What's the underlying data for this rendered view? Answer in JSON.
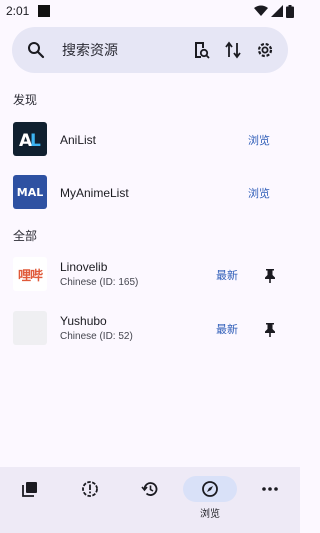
{
  "status": {
    "time": "2:01"
  },
  "search": {
    "placeholder": "搜索资源"
  },
  "sections": {
    "discover": "发现",
    "all": "全部"
  },
  "trackers": [
    {
      "name": "AniList",
      "tile_text": "AL",
      "tile_bg": "#10202f",
      "action": "浏览"
    },
    {
      "name": "MyAnimeList",
      "tile_text": "MAL",
      "tile_bg": "#2e51a2",
      "action": "浏览"
    }
  ],
  "sources": [
    {
      "name": "Linovelib",
      "meta": "Chinese (ID: 165)",
      "tile_text": "哩哔",
      "action": "最新"
    },
    {
      "name": "Yushubo",
      "meta": "Chinese (ID: 52)",
      "tile_text": "",
      "action": "最新"
    }
  ],
  "bottom_nav": {
    "browse_label": "浏览",
    "items": [
      "library-icon",
      "updates-icon",
      "history-icon",
      "browse-icon",
      "more-icon"
    ]
  },
  "colors": {
    "accent": "#2e5db8",
    "background": "#fcf8ff",
    "search_bg": "#e6e6f5",
    "nav_bg": "#eeeaf6"
  }
}
